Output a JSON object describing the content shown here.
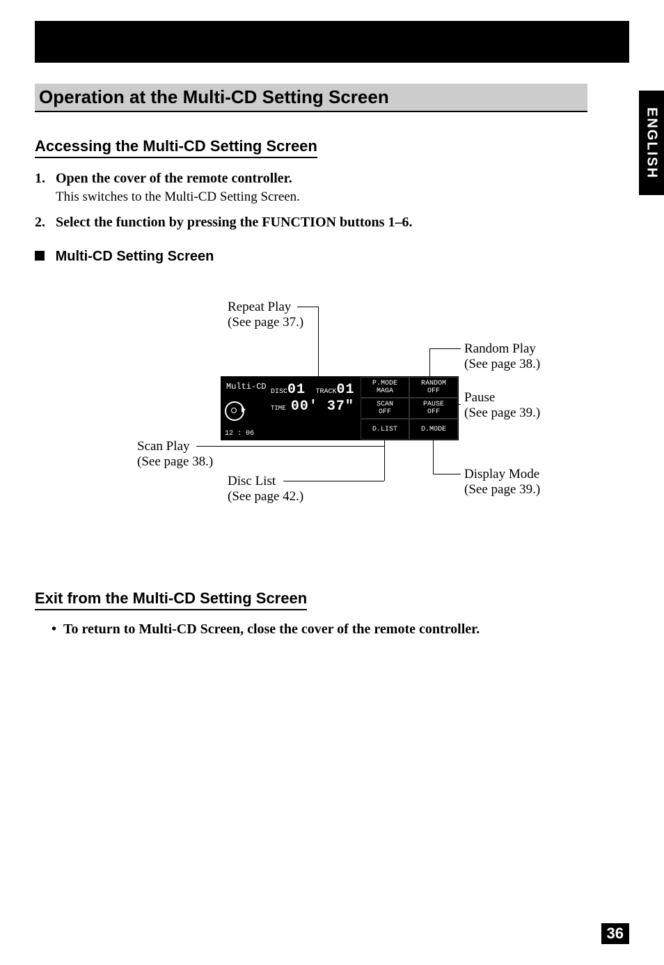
{
  "side_tab": "ENGLISH",
  "page_number": "36",
  "main_title": "Operation at the Multi-CD Setting Screen",
  "section_access": {
    "title": "Accessing the Multi-CD Setting Screen",
    "steps": [
      {
        "num": "1.",
        "bold": "Open the cover of the remote controller.",
        "body": "This switches to the Multi-CD Setting Screen."
      },
      {
        "num": "2.",
        "bold": "Select the function by pressing the FUNCTION buttons 1–6.",
        "body": ""
      }
    ]
  },
  "diagram_heading": "Multi-CD Setting Screen",
  "lcd": {
    "source": "Multi-CD",
    "disc_label": "DISC",
    "disc_num": "01",
    "track_label": "TRACK",
    "track_num": "01",
    "time_label": "TIME",
    "time_val": "00' 37\"",
    "clock": "12 : 06",
    "cells": {
      "pmode_top": "P.MODE",
      "pmode_bot": "MAGA",
      "random_top": "RANDOM",
      "random_bot": "OFF",
      "scan_top": "SCAN",
      "scan_bot": "OFF",
      "pause_top": "PAUSE",
      "pause_bot": "OFF",
      "dlist": "D.LIST",
      "dmode": "D.MODE"
    }
  },
  "callouts": {
    "repeat": {
      "label": "Repeat Play",
      "ref": "(See page 37.)"
    },
    "random": {
      "label": "Random Play",
      "ref": "(See page 38.)"
    },
    "pause": {
      "label": "Pause",
      "ref": "(See page 39.)"
    },
    "dmode": {
      "label": "Display Mode",
      "ref": "(See page 39.)"
    },
    "scan": {
      "label": "Scan Play",
      "ref": "(See page 38.)"
    },
    "dlist": {
      "label": "Disc List",
      "ref": "(See page 42.)"
    }
  },
  "section_exit": {
    "title": "Exit from the Multi-CD Setting Screen",
    "bullet": "To return to Multi-CD Screen, close the cover of the remote controller."
  }
}
